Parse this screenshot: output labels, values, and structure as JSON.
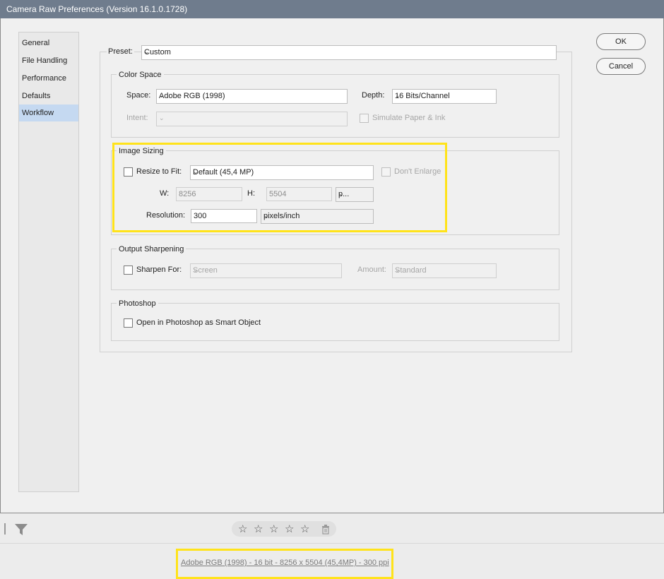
{
  "window": {
    "title": "Camera Raw Preferences  (Version 16.1.0.1728)"
  },
  "sidebar": {
    "items": [
      {
        "label": "General"
      },
      {
        "label": "File Handling"
      },
      {
        "label": "Performance"
      },
      {
        "label": "Defaults"
      },
      {
        "label": "Workflow",
        "selected": true
      }
    ]
  },
  "buttons": {
    "ok": "OK",
    "cancel": "Cancel"
  },
  "preset": {
    "label": "Preset:",
    "value": "Custom"
  },
  "color_space": {
    "title": "Color Space",
    "space_label": "Space:",
    "space_value": "Adobe RGB (1998)",
    "depth_label": "Depth:",
    "depth_value": "16 Bits/Channel",
    "intent_label": "Intent:",
    "intent_value": "",
    "simulate_label": "Simulate Paper & Ink"
  },
  "image_sizing": {
    "title": "Image Sizing",
    "resize_label": "Resize to Fit:",
    "resize_value": "Default  (45,4 MP)",
    "dont_enlarge_label": "Don't Enlarge",
    "w_label": "W:",
    "w_value": "8256",
    "h_label": "H:",
    "h_value": "5504",
    "unit_value": "p...",
    "resolution_label": "Resolution:",
    "resolution_value": "300",
    "resolution_unit": "pixels/inch"
  },
  "output_sharpening": {
    "title": "Output Sharpening",
    "sharpen_label": "Sharpen For:",
    "sharpen_value": "Screen",
    "amount_label": "Amount:",
    "amount_value": "Standard"
  },
  "photoshop": {
    "title": "Photoshop",
    "smart_object_label": "Open in Photoshop as Smart Object"
  },
  "filmstrip": {
    "stars": [
      "☆",
      "☆",
      "☆",
      "☆",
      "☆"
    ],
    "filter_icon": "filter-icon",
    "trash_icon": "trash-icon"
  },
  "footer": {
    "info_link": "Adobe RGB (1998) - 16 bit - 8256 x 5504 (45,4MP) - 300 ppi"
  },
  "colors": {
    "highlight": "#ffe31a",
    "selected_nav": "#c5d9f1",
    "titlebar": "#6f7c8d"
  }
}
